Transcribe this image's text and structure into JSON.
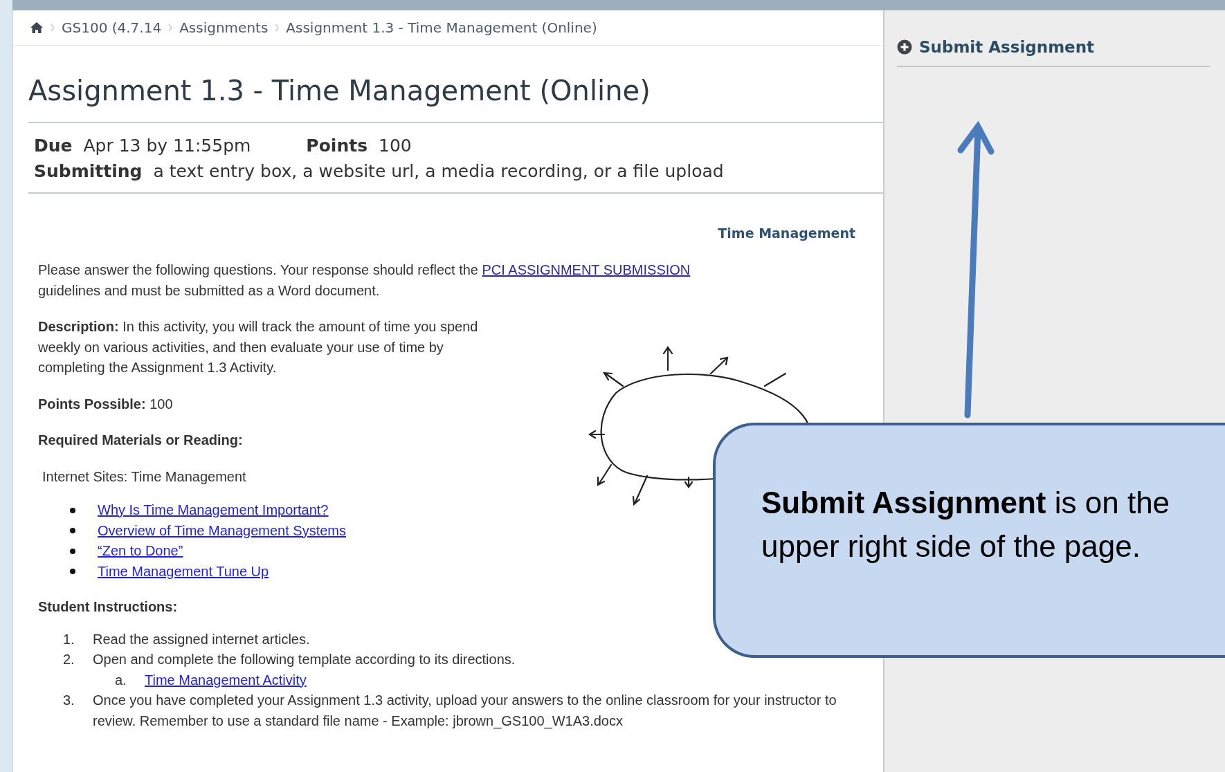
{
  "breadcrumb": {
    "items": [
      "GS100 (4.7.14",
      "Assignments",
      "Assignment 1.3 - Time Management (Online)"
    ]
  },
  "title": "Assignment 1.3 - Time Management (Online)",
  "details": {
    "rows": [
      [
        {
          "label": "Due",
          "value": "Apr 13 by 11:55pm"
        },
        {
          "label": "Points",
          "value": "100"
        }
      ],
      [
        {
          "label": "Submitting",
          "value": "a text entry box, a website url, a media recording, or a file upload"
        }
      ]
    ]
  },
  "body": {
    "heading_link": "Time Management",
    "intro": {
      "before": "Please answer the following questions. Your response should reflect the",
      "link": "PCI ASSIGNMENT SUBMISSION",
      "after": "guidelines and must be submitted as a Word document."
    },
    "description": "**Description:**  In this activity, you will track the amount of time you spend weekly on various activities, and then evaluate your use of time by completing the Assignment 1.3 Activity.",
    "points_possible": "**Points Possible:** 100",
    "required_heading": "Required Materials or Reading:",
    "internet_sites": "Internet Sites: Time Management",
    "links": [
      "Why Is Time Management Important?",
      "Overview of Time Management Systems",
      "“Zen to Done”",
      "Time Management Tune Up"
    ],
    "instructions_heading": "Student Instructions:",
    "steps": [
      {
        "number": "1.",
        "text": "Read the assigned internet articles."
      },
      {
        "number": "2.",
        "text": "Open and complete the following template according to its directions.",
        "children": [
          {
            "number": "a.",
            "link": "Time Management Activity"
          }
        ]
      },
      {
        "number": "3.",
        "text": "Once you have completed your Assignment 1.3 activity, upload your answers to the online classroom for your instructor to review. Remember to use a standard file name - Example: jbrown_GS100_W1A3.docx"
      }
    ]
  },
  "sidebar": {
    "submit_button": "Submit Assignment"
  },
  "callout": {
    "text": "**Submit Assignment** is on the upper right side of the page."
  }
}
